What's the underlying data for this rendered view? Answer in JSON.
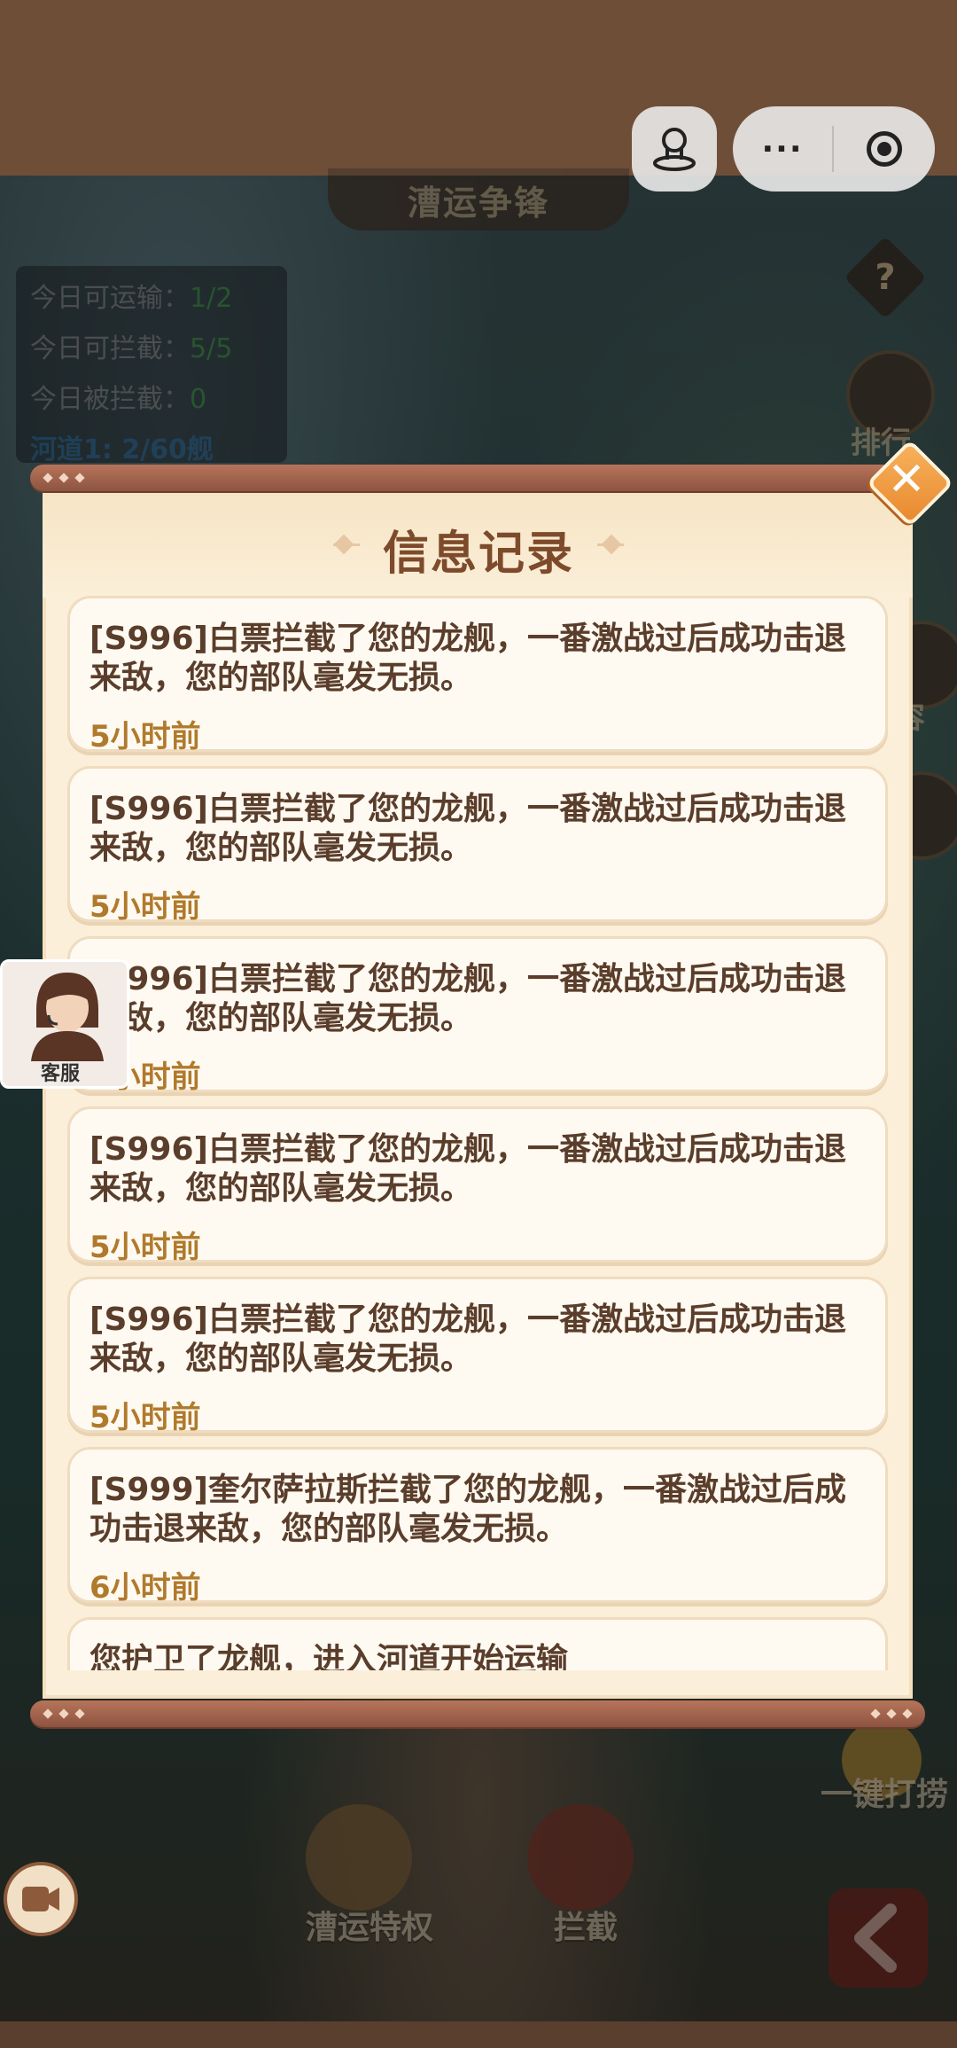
{
  "game": {
    "title": "漕运争锋",
    "stats": {
      "transport_label": "今日可运输：",
      "transport_value": "1/2",
      "intercept_label": "今日可拦截：",
      "intercept_value": "5/5",
      "intercepted_label": "今日被拦截：",
      "intercepted_value": "0",
      "channel_text": "河道1: 2/60舰"
    },
    "side_buttons": {
      "rank": "排行",
      "partial_label": "容"
    },
    "bottom": {
      "privilege": "漕运特权",
      "intercept": "拦截",
      "one_click": "一键打捞"
    }
  },
  "help_icon": "question-icon",
  "customer_service": {
    "label": "客服"
  },
  "modal": {
    "title": "信息记录",
    "close_icon": "close-icon",
    "records": [
      {
        "text": "[S996]白票拦截了您的龙舰，一番激战过后成功击退来敌，您的部队毫发无损。",
        "time": "5小时前"
      },
      {
        "text": "[S996]白票拦截了您的龙舰，一番激战过后成功击退来敌，您的部队毫发无损。",
        "time": "5小时前"
      },
      {
        "text": "[S996]白票拦截了您的龙舰，一番激战过后成功击退来敌，您的部队毫发无损。",
        "time": "5小时前"
      },
      {
        "text": "[S996]白票拦截了您的龙舰，一番激战过后成功击退来敌，您的部队毫发无损。",
        "time": "5小时前"
      },
      {
        "text": "[S996]白票拦截了您的龙舰，一番激战过后成功击退来敌，您的部队毫发无损。",
        "time": "5小时前"
      },
      {
        "text": "[S999]奎尔萨拉斯拦截了您的龙舰，一番激战过后成功击退来敌，您的部队毫发无损。",
        "time": "6小时前"
      },
      {
        "text": "您护卫了龙舰，进入河道开始运输",
        "time": ""
      }
    ]
  },
  "capsule": {
    "more": "···"
  }
}
